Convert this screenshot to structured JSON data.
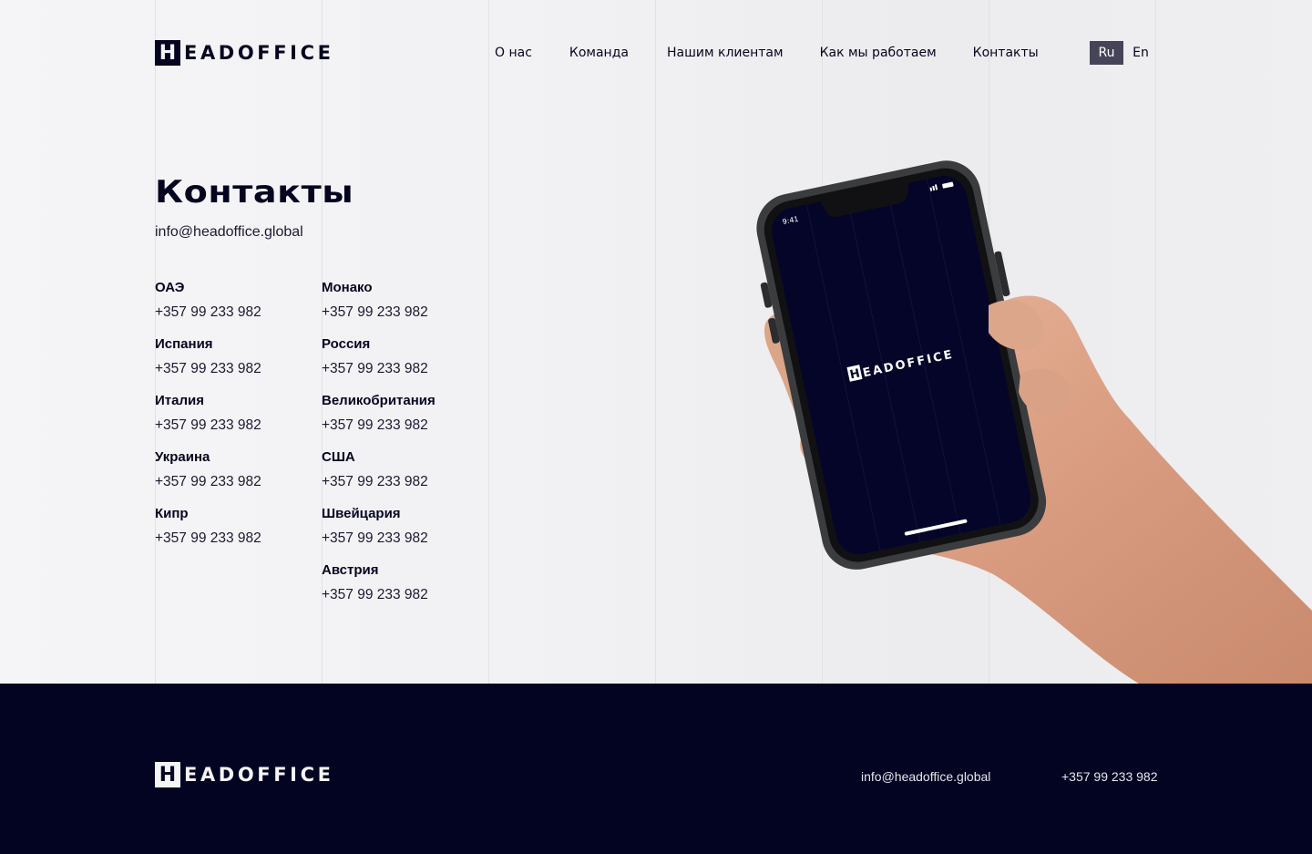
{
  "header": {
    "logo": {
      "letter": "H",
      "rest": "EADOFFICE"
    },
    "nav": [
      {
        "label": "О нас"
      },
      {
        "label": "Команда"
      },
      {
        "label": "Нашим клиентам"
      },
      {
        "label": "Как мы работаем"
      },
      {
        "label": "Контакты"
      }
    ],
    "languages": {
      "active": "Ru",
      "inactive": "En"
    }
  },
  "main": {
    "title": "Контакты",
    "email": "info@headoffice.global",
    "offices_left": [
      {
        "country": "ОАЭ",
        "phone": "+357 99 233 982"
      },
      {
        "country": "Испания",
        "phone": "+357 99 233 982"
      },
      {
        "country": "Италия",
        "phone": "+357 99 233 982"
      },
      {
        "country": "Украина",
        "phone": "+357 99 233 982"
      },
      {
        "country": "Кипр",
        "phone": "+357 99 233 982"
      }
    ],
    "offices_right": [
      {
        "country": "Монако",
        "phone": "+357 99 233 982"
      },
      {
        "country": "Россия",
        "phone": "+357 99 233 982"
      },
      {
        "country": "Великобритания",
        "phone": "+357 99 233 982"
      },
      {
        "country": "США",
        "phone": "+357 99 233 982"
      },
      {
        "country": "Швейцария",
        "phone": "+357 99 233 982"
      },
      {
        "country": "Австрия",
        "phone": "+357 99 233 982"
      }
    ]
  },
  "phone_mockup": {
    "time": "9:41",
    "screen_logo": "HEADOFFICE",
    "screen_color": "#05052a"
  },
  "footer": {
    "logo": {
      "letter": "H",
      "rest": "EADOFFICE"
    },
    "email": "info@headoffice.global",
    "phone": "+357 99 233 982"
  },
  "colors": {
    "brand_dark": "#030322",
    "active_lang_bg": "#454459"
  }
}
